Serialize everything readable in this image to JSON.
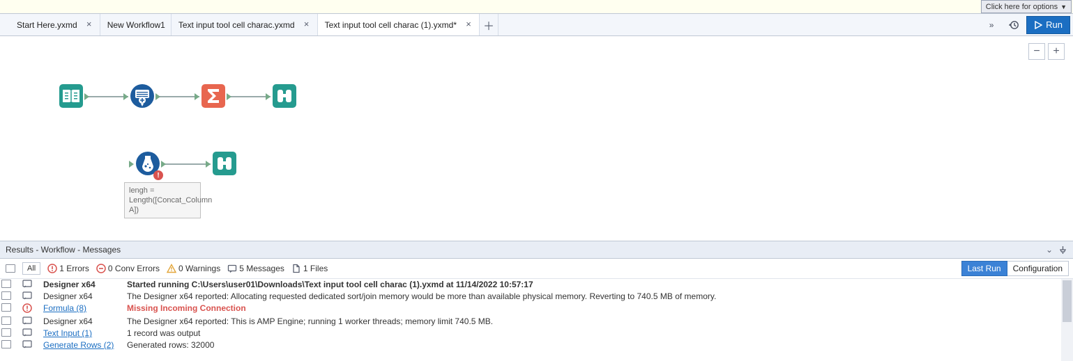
{
  "options_button": "Click here for options",
  "tabs": [
    {
      "label": "Start Here.yxmd",
      "active": false
    },
    {
      "label": "New Workflow1",
      "active": false
    },
    {
      "label": "Text input tool cell charac.yxmd",
      "active": false
    },
    {
      "label": "Text input tool cell charac (1).yxmd*",
      "active": true
    }
  ],
  "run_label": "Run",
  "canvas": {
    "annotation": "lengh = Length([Concat_Column A])"
  },
  "results_header": "Results - Workflow - Messages",
  "filters": {
    "all": "All",
    "errors_count": "1 Errors",
    "conv_errors_count": "0 Conv Errors",
    "warnings_count": "0 Warnings",
    "messages_count": "5 Messages",
    "files_count": "1 Files",
    "last_run": "Last Run",
    "configuration": "Configuration"
  },
  "messages": [
    {
      "icon": "msg",
      "source": "Designer x64",
      "link": false,
      "style": "bold",
      "text": "Started running C:\\Users\\user01\\Downloads\\Text input tool cell charac (1).yxmd at 11/14/2022 10:57:17"
    },
    {
      "icon": "msg",
      "source": "Designer x64",
      "link": false,
      "style": "",
      "text": "The Designer x64 reported: Allocating requested dedicated sort/join memory would be more than available physical memory. Reverting to 740.5 MB of memory."
    },
    {
      "icon": "err",
      "source": "Formula (8)",
      "link": true,
      "style": "error",
      "text": "Missing Incoming Connection"
    },
    {
      "icon": "msg",
      "source": "Designer x64",
      "link": false,
      "style": "",
      "text": "The Designer x64 reported: This is AMP Engine; running 1 worker threads; memory limit 740.5 MB."
    },
    {
      "icon": "msg",
      "source": "Text Input (1)",
      "link": true,
      "style": "",
      "text": "1 record was output"
    },
    {
      "icon": "msg",
      "source": "Generate Rows (2)",
      "link": true,
      "style": "",
      "text": "Generated rows: 32000"
    }
  ]
}
